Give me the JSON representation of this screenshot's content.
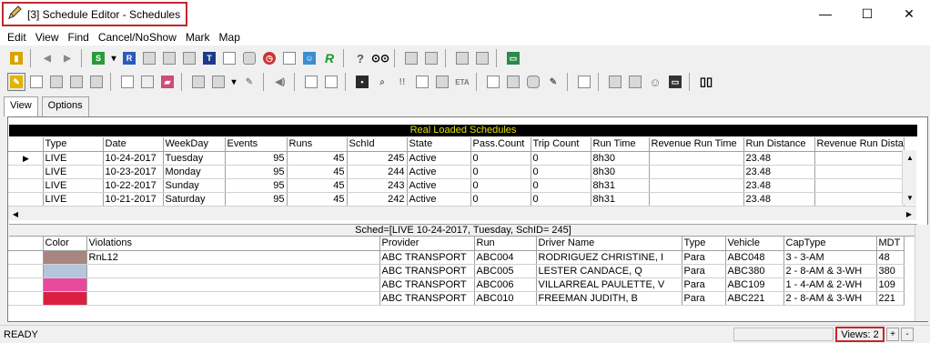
{
  "window": {
    "title": "[3] Schedule Editor - Schedules",
    "minimize": "—",
    "maximize": "☐",
    "close": "✕"
  },
  "menu": [
    "Edit",
    "View",
    "Find",
    "Cancel/NoShow",
    "Mark",
    "Map"
  ],
  "tabs": [
    "View",
    "Options"
  ],
  "schedules": {
    "header": "Real Loaded Schedules",
    "columns": [
      "Type",
      "Date",
      "WeekDay",
      "Events",
      "Runs",
      "SchId",
      "State",
      "Pass.Count",
      "Trip Count",
      "Run Time",
      "Revenue Run Time",
      "Run Distance",
      "Revenue Run Dista"
    ],
    "rows": [
      [
        "LIVE",
        "10-24-2017",
        "Tuesday",
        "95",
        "45",
        "245",
        "Active",
        "0",
        "0",
        "8h30",
        "",
        "23.48",
        ""
      ],
      [
        "LIVE",
        "10-23-2017",
        "Monday",
        "95",
        "45",
        "244",
        "Active",
        "0",
        "0",
        "8h30",
        "",
        "23.48",
        ""
      ],
      [
        "LIVE",
        "10-22-2017",
        "Sunday",
        "95",
        "45",
        "243",
        "Active",
        "0",
        "0",
        "8h31",
        "",
        "23.48",
        ""
      ],
      [
        "LIVE",
        "10-21-2017",
        "Saturday",
        "95",
        "45",
        "242",
        "Active",
        "0",
        "0",
        "8h31",
        "",
        "23.48",
        ""
      ]
    ]
  },
  "sched": {
    "header": "Sched=[LIVE 10-24-2017, Tuesday, SchID= 245]",
    "columns": [
      "Color",
      "Violations",
      "Provider",
      "Run",
      "Driver Name",
      "Type",
      "Vehicle",
      "CapType",
      "MDT"
    ],
    "rows": [
      {
        "color": "#a98582",
        "cells": [
          "",
          "RnL12",
          "ABC TRANSPORT",
          "ABC004",
          "RODRIGUEZ CHRISTINE, I",
          "Para",
          "ABC048",
          "3 - 3-AM",
          "48"
        ]
      },
      {
        "color": "#b3c6dc",
        "cells": [
          "",
          "",
          "ABC TRANSPORT",
          "ABC005",
          "LESTER CANDACE, Q",
          "Para",
          "ABC380",
          "2 - 8-AM & 3-WH",
          "380"
        ]
      },
      {
        "color": "#e84a9e",
        "cells": [
          "",
          "",
          "ABC TRANSPORT",
          "ABC006",
          "VILLARREAL PAULETTE, V",
          "Para",
          "ABC109",
          "1 - 4-AM & 2-WH",
          "109"
        ]
      },
      {
        "color": "#d9213f",
        "cells": [
          "",
          "",
          "ABC TRANSPORT",
          "ABC010",
          "FREEMAN JUDITH, B",
          "Para",
          "ABC221",
          "2 - 8-AM & 3-WH",
          "221"
        ]
      }
    ]
  },
  "status": {
    "ready": "READY",
    "views": "Views: 2",
    "plus": "+",
    "minus": "-"
  },
  "toolbar_icons": {
    "row1": [
      "door-icon",
      "back-icon",
      "forward-icon",
      "s-icon",
      "dropdown-icon",
      "r-icon",
      "filter-icon",
      "filter2-icon",
      "lock-icon",
      "t-icon",
      "list-icon",
      "bus-icon",
      "clock-icon",
      "video-icon",
      "people-icon",
      "r-green-icon",
      "help-icon",
      "binoculars-icon",
      "map1-icon",
      "map2-icon",
      "truck-icon",
      "bus2-icon",
      "monitor-icon"
    ],
    "row2": [
      "highlight-icon",
      "grid-icon",
      "gray1-icon",
      "gray2-icon",
      "gray3-icon",
      "split-icon",
      "edit-icon",
      "eraser-icon",
      "expand-icon",
      "collapse-icon",
      "dropdown2-icon",
      "pencil-icon",
      "sound-icon",
      "text-icon",
      "chart-icon",
      "picture-icon",
      "zoom-icon",
      "alert-icon",
      "table-icon",
      "shuffle-icon",
      "eta-icon",
      "checklist-icon",
      "print-icon",
      "car-icon",
      "wrench-icon",
      "notes-icon",
      "copy-icon",
      "refresh-icon",
      "smiley-icon",
      "screen-icon",
      "book-icon"
    ]
  }
}
